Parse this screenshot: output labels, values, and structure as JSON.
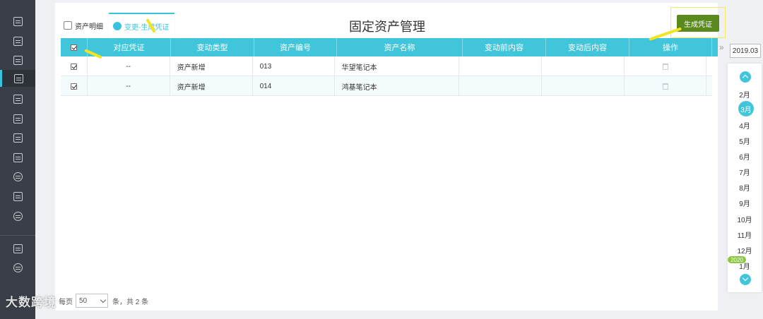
{
  "sidebar": {
    "items": [
      {
        "icon": "list-icon"
      },
      {
        "icon": "yuan-icon"
      },
      {
        "icon": "chart-icon"
      },
      {
        "icon": "building-icon",
        "active": true
      },
      {
        "icon": "calendar-icon"
      },
      {
        "icon": "book-icon"
      },
      {
        "icon": "archive-icon"
      },
      {
        "icon": "image-icon"
      },
      {
        "icon": "coins-icon"
      },
      {
        "icon": "report-icon"
      },
      {
        "icon": "settings-icon"
      },
      {
        "icon": "play-icon"
      },
      {
        "icon": "gauge-icon"
      }
    ]
  },
  "tabs": [
    {
      "label": "资产明细"
    },
    {
      "label": "变更-生成凭证",
      "active": true
    }
  ],
  "page_title": "固定资产管理",
  "generate_button": "生成凭证",
  "table": {
    "headers": [
      "对应凭证",
      "变动类型",
      "资产编号",
      "资产名称",
      "变动前内容",
      "变动后内容",
      "操作"
    ],
    "rows": [
      {
        "voucher": "--",
        "type": "资产新增",
        "code": "013",
        "name": "华望笔记本",
        "before": "",
        "after": ""
      },
      {
        "voucher": "--",
        "type": "资产新增",
        "code": "014",
        "name": "鸿基笔记本",
        "before": "",
        "after": ""
      }
    ]
  },
  "footer": {
    "per_page_label": "每页",
    "per_page_value": "50",
    "summary": "条，共 2 条"
  },
  "date_panel": {
    "current": "2019.03",
    "months": [
      "2月",
      "3月",
      "4月",
      "5月",
      "6月",
      "7月",
      "8月",
      "9月",
      "10月",
      "11月",
      "12月",
      "1月"
    ],
    "selected_month": "3月",
    "year_badge": "2020"
  },
  "watermark": "大数跨境",
  "colors": {
    "accent": "#41c5da",
    "sidebar": "#3a3f47",
    "button": "#5a8a1e",
    "annotation": "#f2e51c"
  }
}
